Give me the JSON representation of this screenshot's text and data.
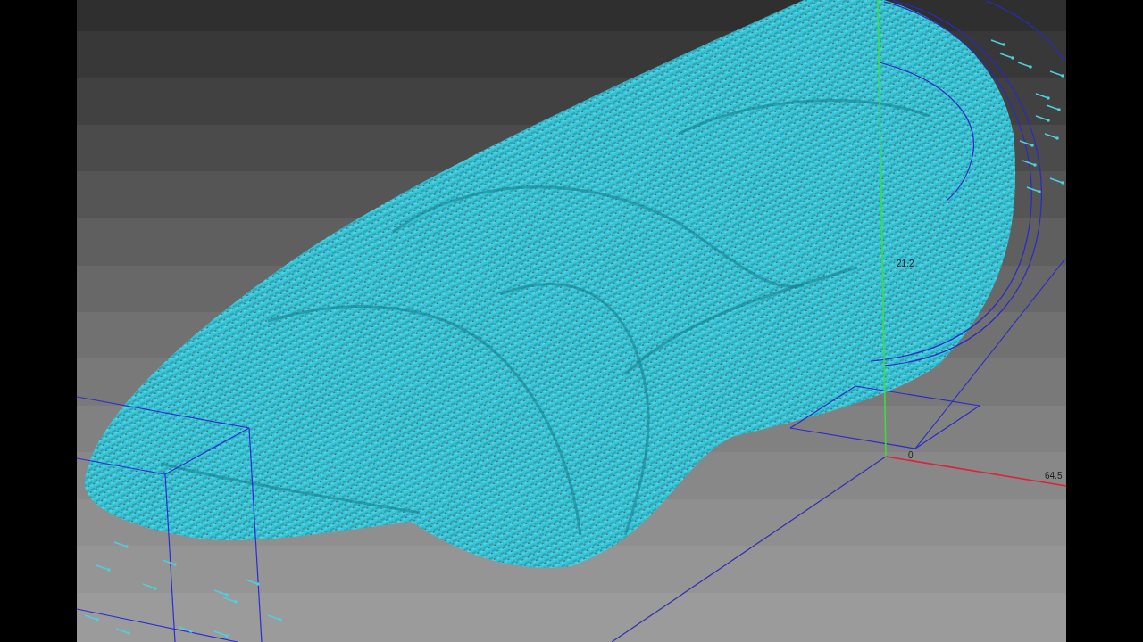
{
  "viewport": {
    "axis_labels": [
      {
        "kind": "vertical",
        "text": "21.2"
      },
      {
        "kind": "origin",
        "text": "0"
      },
      {
        "kind": "horizontal",
        "text": "64.5"
      }
    ]
  }
}
